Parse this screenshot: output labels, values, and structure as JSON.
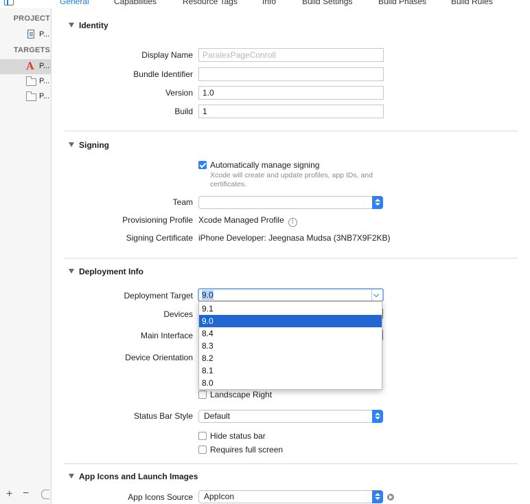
{
  "tabs": [
    {
      "label": "General",
      "active": true
    },
    {
      "label": "Capabilities"
    },
    {
      "label": "Resource Tags"
    },
    {
      "label": "Info"
    },
    {
      "label": "Build Settings"
    },
    {
      "label": "Build Phases"
    },
    {
      "label": "Build Rules"
    }
  ],
  "sidebar": {
    "project_header": "PROJECT",
    "project_item": "P...",
    "targets_header": "TARGETS",
    "targets": [
      "P...",
      "P...",
      "P..."
    ]
  },
  "identity": {
    "title": "Identity",
    "display_name_label": "Display Name",
    "display_name_placeholder": "ParalexPageConroll",
    "bundle_identifier_label": "Bundle Identifier",
    "bundle_identifier_value": "",
    "version_label": "Version",
    "version_value": "1.0",
    "build_label": "Build",
    "build_value": "1"
  },
  "signing": {
    "title": "Signing",
    "auto_manage_label": "Automatically manage signing",
    "auto_manage_checked": true,
    "auto_manage_hint": "Xcode will create and update profiles, app IDs, and certificates.",
    "team_label": "Team",
    "team_value": "",
    "provisioning_label": "Provisioning Profile",
    "provisioning_value": "Xcode Managed Profile",
    "certificate_label": "Signing Certificate",
    "certificate_value": "iPhone Developer: Jeegnasa Mudsa (3NB7X9F2KB)"
  },
  "deployment": {
    "title": "Deployment Info",
    "target_label": "Deployment Target",
    "target_value": "9.0",
    "target_options": [
      "9.1",
      "9.0",
      "8.4",
      "8.3",
      "8.2",
      "8.1",
      "8.0"
    ],
    "selected_option": "9.0",
    "devices_label": "Devices",
    "main_interface_label": "Main Interface",
    "orientation_label": "Device Orientation",
    "landscape_right_label": "Landscape Right",
    "status_bar_style_label": "Status Bar Style",
    "status_bar_style_value": "Default",
    "hide_status_bar_label": "Hide status bar",
    "requires_full_screen_label": "Requires full screen"
  },
  "app_icons": {
    "title": "App Icons and Launch Images",
    "source_label": "App Icons Source",
    "source_value": "AppIcon"
  },
  "colors": {
    "accent": "#2f7ff5",
    "selection": "#2167d2",
    "tab_active": "#2a77d6"
  }
}
